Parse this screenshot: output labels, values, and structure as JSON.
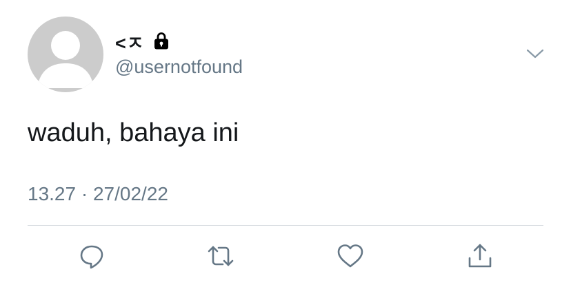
{
  "user": {
    "display_name": "<ㅈ",
    "handle": "@usernotfound",
    "protected_icon": "lock-icon",
    "avatar_icon": "default-avatar-icon"
  },
  "tweet": {
    "text": "waduh, bahaya ini",
    "time": "13.27",
    "separator": "·",
    "date": "27/02/22"
  },
  "actions": [
    {
      "icon": "reply-icon"
    },
    {
      "icon": "retweet-icon"
    },
    {
      "icon": "like-icon"
    },
    {
      "icon": "share-icon"
    }
  ],
  "menu_icon": "chevron-down-icon",
  "colors": {
    "text": "#14171a",
    "secondary": "#657786",
    "avatar_bg": "#cccccc",
    "divider": "#d6dbe0"
  }
}
